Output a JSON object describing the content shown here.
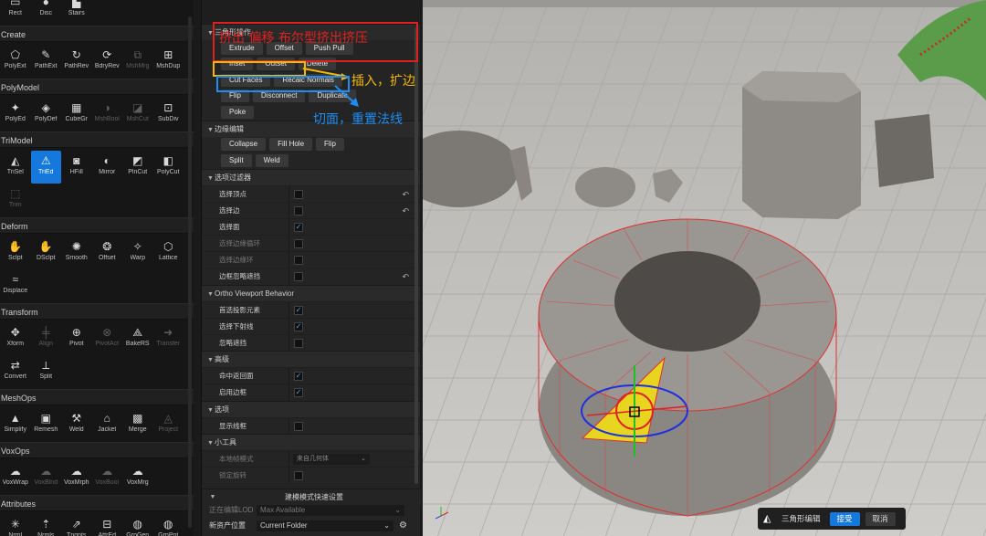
{
  "palette": {
    "top_tools": [
      {
        "label": "Rect",
        "icon": "rect-icon",
        "glyph": "▭"
      },
      {
        "label": "Disc",
        "icon": "disc-icon",
        "glyph": "●"
      },
      {
        "label": "Stairs",
        "icon": "stairs-icon",
        "glyph": "▙"
      }
    ],
    "categories": [
      {
        "title": "Create",
        "tools": [
          {
            "label": "PolyExt",
            "icon": "poly-extrude-icon",
            "glyph": "⬠"
          },
          {
            "label": "PathExt",
            "icon": "path-extrude-icon",
            "glyph": "✎"
          },
          {
            "label": "PathRev",
            "icon": "path-revolve-icon",
            "glyph": "↻"
          },
          {
            "label": "BdryRev",
            "icon": "boundary-revolve-icon",
            "glyph": "⟳"
          },
          {
            "label": "MshMrg",
            "icon": "mesh-merge-icon",
            "glyph": "⧉",
            "dim": true
          },
          {
            "label": "MshDup",
            "icon": "mesh-duplicate-icon",
            "glyph": "⊞"
          }
        ]
      },
      {
        "title": "PolyModel",
        "tools": [
          {
            "label": "PolyEd",
            "icon": "poly-edit-icon",
            "glyph": "✦"
          },
          {
            "label": "PolyDef",
            "icon": "poly-deform-icon",
            "glyph": "◈"
          },
          {
            "label": "CubeGr",
            "icon": "cube-grid-icon",
            "glyph": "▦"
          },
          {
            "label": "MshBool",
            "icon": "mesh-boolean-icon",
            "glyph": "◑",
            "dim": true
          },
          {
            "label": "MshCut",
            "icon": "mesh-cut-icon",
            "glyph": "◪",
            "dim": true
          },
          {
            "label": "SubDiv",
            "icon": "subdivide-icon",
            "glyph": "⊡"
          }
        ]
      },
      {
        "title": "TriModel",
        "tools": [
          {
            "label": "TriSel",
            "icon": "tri-select-icon",
            "glyph": "◭"
          },
          {
            "label": "TriEd",
            "icon": "tri-edit-icon",
            "glyph": "⚠",
            "active": true
          },
          {
            "label": "HFill",
            "icon": "hole-fill-icon",
            "glyph": "◙"
          },
          {
            "label": "Mirror",
            "icon": "mirror-icon",
            "glyph": "◐"
          },
          {
            "label": "PlnCut",
            "icon": "plane-cut-icon",
            "glyph": "◩"
          },
          {
            "label": "PolyCut",
            "icon": "poly-cut-icon",
            "glyph": "◧"
          },
          {
            "label": "Trim",
            "icon": "trim-icon",
            "glyph": "⬚",
            "dim": true
          }
        ]
      },
      {
        "title": "Deform",
        "tools": [
          {
            "label": "Sclpt",
            "icon": "sculpt-icon",
            "glyph": "✋"
          },
          {
            "label": "DSclpt",
            "icon": "dyna-sculpt-icon",
            "glyph": "✋"
          },
          {
            "label": "Smooth",
            "icon": "smooth-icon",
            "glyph": "✺"
          },
          {
            "label": "Offset",
            "icon": "offset-icon",
            "glyph": "❂"
          },
          {
            "label": "Warp",
            "icon": "warp-icon",
            "glyph": "✧"
          },
          {
            "label": "Lattice",
            "icon": "lattice-icon",
            "glyph": "⬡"
          },
          {
            "label": "Displace",
            "icon": "displace-icon",
            "glyph": "≈"
          }
        ]
      },
      {
        "title": "Transform",
        "tools": [
          {
            "label": "Xform",
            "icon": "transform-icon",
            "glyph": "✥"
          },
          {
            "label": "Align",
            "icon": "align-icon",
            "glyph": "╪",
            "dim": true
          },
          {
            "label": "Pivot",
            "icon": "pivot-icon",
            "glyph": "⊕"
          },
          {
            "label": "PivotAct",
            "icon": "pivot-actor-icon",
            "glyph": "⊗",
            "dim": true
          },
          {
            "label": "BakeRS",
            "icon": "bake-rs-icon",
            "glyph": "⟁"
          },
          {
            "label": "Transfer",
            "icon": "transfer-icon",
            "glyph": "➜",
            "dim": true
          },
          {
            "label": "Convert",
            "icon": "convert-icon",
            "glyph": "⇄"
          },
          {
            "label": "Split",
            "icon": "split-icon",
            "glyph": "⟂"
          }
        ]
      },
      {
        "title": "MeshOps",
        "tools": [
          {
            "label": "Simplify",
            "icon": "simplify-icon",
            "glyph": "▲"
          },
          {
            "label": "Remesh",
            "icon": "remesh-icon",
            "glyph": "▣"
          },
          {
            "label": "Weld",
            "icon": "weld-icon",
            "glyph": "⚒"
          },
          {
            "label": "Jacket",
            "icon": "jacket-icon",
            "glyph": "⌂"
          },
          {
            "label": "Merge",
            "icon": "merge-icon",
            "glyph": "▩"
          },
          {
            "label": "Project",
            "icon": "project-icon",
            "glyph": "◬",
            "dim": true
          }
        ]
      },
      {
        "title": "VoxOps",
        "tools": [
          {
            "label": "VoxWrap",
            "icon": "vox-wrap-icon",
            "glyph": "☁"
          },
          {
            "label": "VoxBlnd",
            "icon": "vox-blend-icon",
            "glyph": "☁",
            "dim": true
          },
          {
            "label": "VoxMrph",
            "icon": "vox-morph-icon",
            "glyph": "☁"
          },
          {
            "label": "VoxBool",
            "icon": "vox-boolean-icon",
            "glyph": "☁",
            "dim": true
          },
          {
            "label": "VoxMrg",
            "icon": "vox-merge-icon",
            "glyph": "☁"
          }
        ]
      },
      {
        "title": "Attributes",
        "tools": [
          {
            "label": "Nrml",
            "icon": "normals-icon",
            "glyph": "✳"
          },
          {
            "label": "Nrmls",
            "icon": "normals-edit-icon",
            "glyph": "⇡"
          },
          {
            "label": "Tngnts",
            "icon": "tangents-icon",
            "glyph": "⇗"
          },
          {
            "label": "AttrEd",
            "icon": "attribute-edit-icon",
            "glyph": "⊟"
          },
          {
            "label": "GrpGen",
            "icon": "group-gen-icon",
            "glyph": "◍"
          },
          {
            "label": "GrpPnt",
            "icon": "group-paint-icon",
            "glyph": "◍"
          }
        ]
      }
    ]
  },
  "details": {
    "section_ops": "三角形操作",
    "row1": [
      "Extrude",
      "Offset",
      "Push Pull"
    ],
    "row2": [
      "Inset",
      "Outset",
      "Delete"
    ],
    "row3": [
      "Cut Faces",
      "Recalc Normals"
    ],
    "row4": [
      "Flip",
      "Disconnect",
      "Duplicate"
    ],
    "row5": [
      "Poke"
    ],
    "section_edge": "边缘编辑",
    "edge_row1": [
      "Collapse",
      "Fill Hole",
      "Flip"
    ],
    "edge_row2": [
      "Split",
      "Weld"
    ],
    "section_filter": "选项过滤器",
    "filter_props": [
      {
        "label": "选择顶点",
        "checked": false,
        "reset": true
      },
      {
        "label": "选择边",
        "checked": false,
        "reset": true
      },
      {
        "label": "选择面",
        "checked": true
      },
      {
        "label": "选择边缘循环",
        "checked": false,
        "dim": true
      },
      {
        "label": "选择边缘环",
        "checked": false,
        "dim": true
      },
      {
        "label": "边框忽略遮挡",
        "checked": false,
        "reset": true
      }
    ],
    "section_ortho": "Ortho Viewport Behavior",
    "ortho_props": [
      {
        "label": "首选投影元素",
        "checked": true
      },
      {
        "label": "选择下射线",
        "checked": true
      },
      {
        "label": "忽略遮挡",
        "checked": false
      }
    ],
    "section_advanced": "高级",
    "advanced_props": [
      {
        "label": "命中返回面",
        "checked": true
      },
      {
        "label": "启用边框",
        "checked": true
      }
    ],
    "section_options": "选项",
    "options_props": [
      {
        "label": "显示线框",
        "checked": false
      }
    ],
    "section_gizmo": "小工具",
    "gizmo_props": [
      {
        "label": "本地帧模式",
        "dropdown": "来自几何体",
        "dim": true
      },
      {
        "label": "锁定旋转",
        "checked": false,
        "dim": true
      }
    ],
    "quick_settings": "建模模式快速设置",
    "lod_label": "正在编辑LOD",
    "lod_value": "Max Available",
    "asset_label": "新资产位置",
    "asset_value": "Current Folder"
  },
  "annotations": {
    "red_text": "挤出    偏移    布尔型挤出挤压",
    "yellow_text": "插入，扩边",
    "blue_text": "切面，重置法线",
    "red_color": "#e0201e",
    "yellow_color": "#f5b800",
    "blue_color": "#1e8cf0"
  },
  "viewport": {
    "tool_name": "三角形编辑",
    "accept": "接受",
    "cancel": "取消"
  }
}
